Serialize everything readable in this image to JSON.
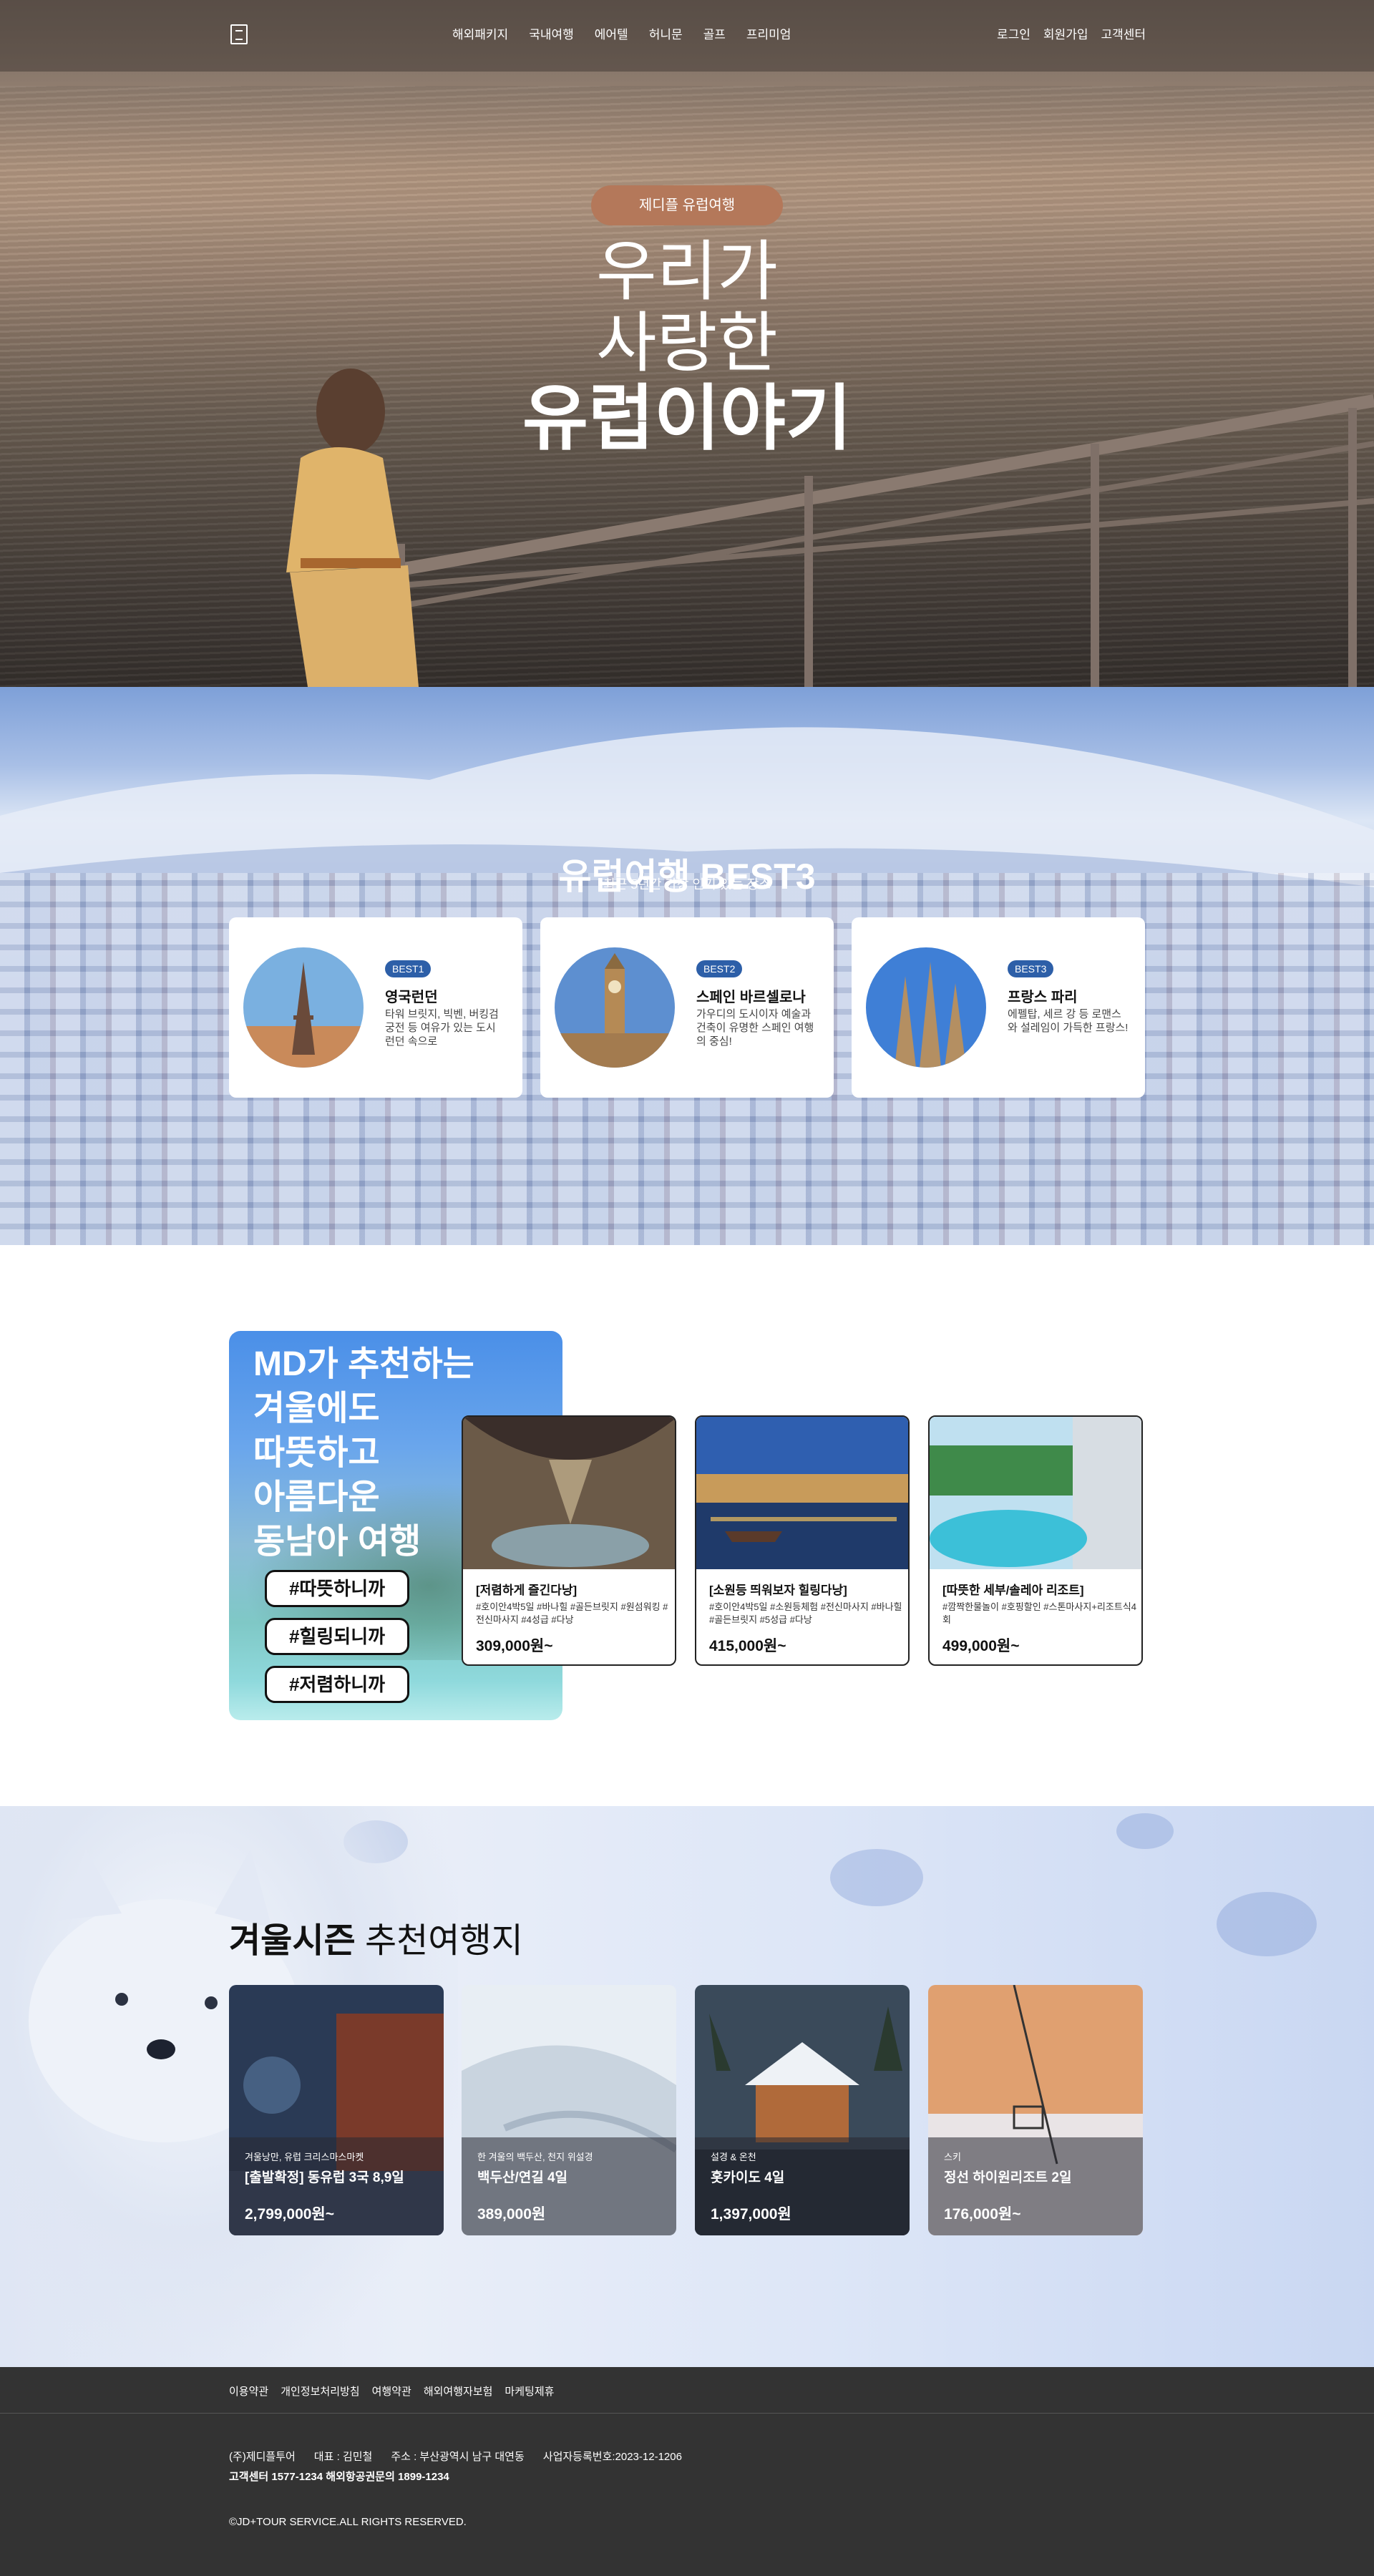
{
  "nav": {
    "logo_icon": "logo-icon",
    "main_menu": [
      "해외패키지",
      "국내여행",
      "에어텔",
      "허니문",
      "골프",
      "프리미엄"
    ],
    "user_menu": [
      "로그인",
      "회원가입",
      "고객센터"
    ]
  },
  "hero": {
    "badge": "제디플 유럽여행",
    "line1": "우리가",
    "line2": "사랑한",
    "line3": "유럽이야기"
  },
  "best": {
    "title": "유럽여행 BEST3",
    "subtitle": "최근 5년간 가장 인기 있는 장소",
    "cards": [
      {
        "tag": "BEST1",
        "name": "영국런던",
        "desc": "타워 브릿지, 빅벤, 버킹검 궁전 등 여유가 있는 도시 런던 속으로",
        "image": "eiffel-tower-image"
      },
      {
        "tag": "BEST2",
        "name": "스페인 바르셀로나",
        "desc": "가우디의 도시이자 예술과 건축이 유명한 스페인 여행의 중심!",
        "image": "big-ben-image"
      },
      {
        "tag": "BEST3",
        "name": "프랑스 파리",
        "desc": "에펠탑, 세르 강 등 로맨스와 설레임이 가득한 프랑스!",
        "image": "sagrada-familia-image"
      }
    ]
  },
  "md": {
    "title_lines": [
      "MD가 추천하는",
      "겨울에도",
      "따뜻하고",
      "아름다운",
      "동남아 여행"
    ],
    "hashtags": [
      "#따뜻하니까",
      "#힐링되니까",
      "#저렴하니까"
    ],
    "products": [
      {
        "title": "[저렴하게 즐긴다낭]",
        "tags": "#호이안4박5일 #바나힐 #골든브릿지 #원섬워킹 #전신마사지 #4성급 #다낭",
        "price": "309,000원~"
      },
      {
        "title": "[소원등 띄워보자 힐링다낭]",
        "tags": "#호이안4박5일 #소원등체험 #전신마사지 #바나힐 #골든브릿지 #5성급 #다낭",
        "price": "415,000원~"
      },
      {
        "title": "[따뜻한 세부/솔레아 리조트]",
        "tags": "#깜짝한물놀이 #호핑할인 #스톤마사지+리조트식4회",
        "price": "499,000원~"
      }
    ]
  },
  "winter": {
    "title_bold": "겨울시즌",
    "title_rest": " 추천여행지",
    "cards": [
      {
        "sub": "겨울낭만, 유럽 크리스마스마켓",
        "name": "[출발확정] 동유럽 3국 8,9일",
        "price": "2,799,000원~"
      },
      {
        "sub": "한 겨울의 백두산, 천지 위설경",
        "name": "백두산/연길 4일",
        "price": "389,000원"
      },
      {
        "sub": "설경 & 온천",
        "name": "홋카이도 4일",
        "price": "1,397,000원"
      },
      {
        "sub": "스키",
        "name": "정선 하이원리조트 2일",
        "price": "176,000원~"
      }
    ]
  },
  "footer": {
    "links": [
      "이용약관",
      "개인정보처리방침",
      "여행약관",
      "해외여행자보험",
      "마케팅제휴"
    ],
    "info": [
      "(주)제디플투어",
      "대표 : 김민철",
      "주소 : 부산광역시 남구 대연동",
      "사업자등록번호:2023-12-1206"
    ],
    "cs": "고객센터 1577-1234  해외항공권문의 1899-1234",
    "copyright": "©JD+TOUR SERVICE.ALL RIGHTS RESERVED."
  },
  "colors": {
    "hero_badge": "#b4785a",
    "best_tag": "#2d5fa8",
    "footer_bg": "#333333"
  }
}
